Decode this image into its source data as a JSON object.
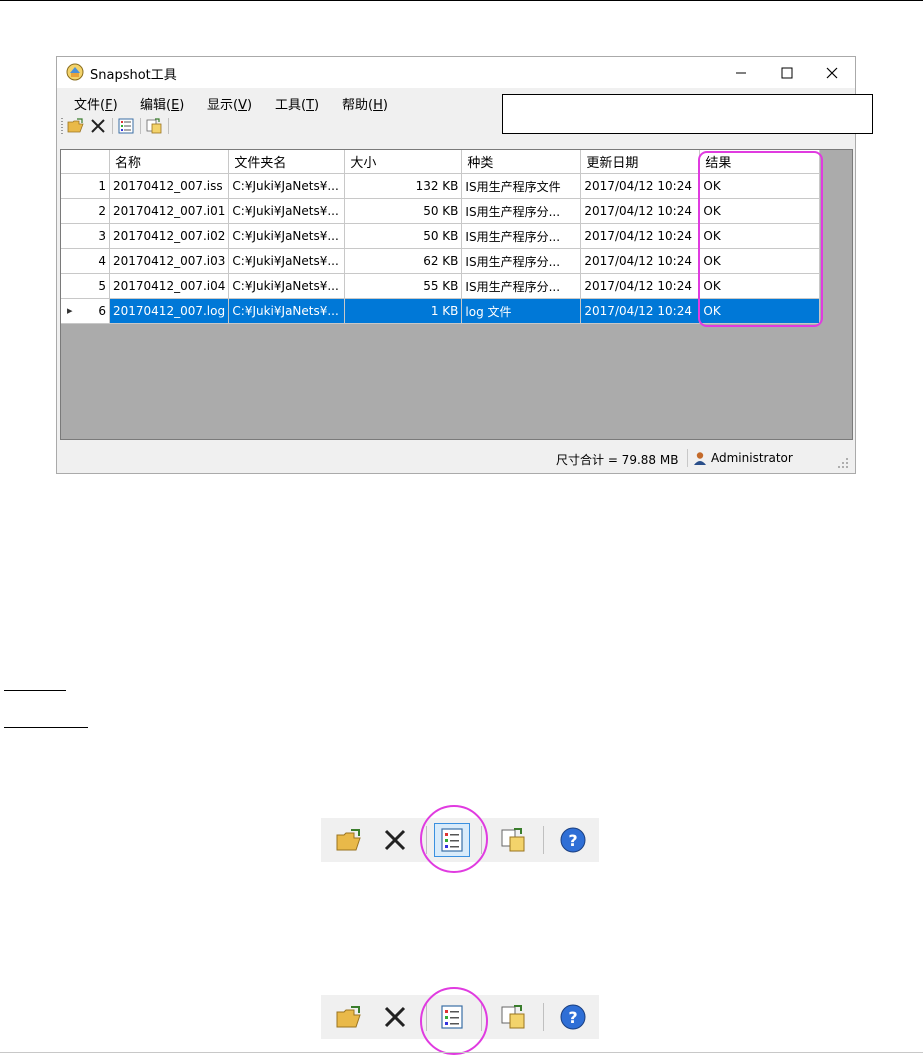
{
  "window": {
    "title": "Snapshot工具",
    "caption": {
      "minimize": "—",
      "maximize": "☐",
      "close": "✕"
    }
  },
  "menu": [
    {
      "label": "文件(",
      "key": "F",
      "tail": ")"
    },
    {
      "label": "编辑(",
      "key": "E",
      "tail": ")"
    },
    {
      "label": "显示(",
      "key": "V",
      "tail": ")"
    },
    {
      "label": "工具(",
      "key": "T",
      "tail": ")"
    },
    {
      "label": "帮助(",
      "key": "H",
      "tail": ")"
    }
  ],
  "grid": {
    "columns": [
      "名称",
      "文件夹名",
      "大小",
      "种类",
      "更新日期",
      "结果"
    ],
    "rows": [
      {
        "index": "1",
        "name": "20170412_007.iss",
        "folder": "C:¥Juki¥JaNets¥...",
        "size": "132 KB",
        "kind": "IS用生产程序文件",
        "date": "2017/04/12 10:24",
        "result": "OK",
        "selected": false
      },
      {
        "index": "2",
        "name": "20170412_007.i01",
        "folder": "C:¥Juki¥JaNets¥...",
        "size": "50 KB",
        "kind": "IS用生产程序分...",
        "date": "2017/04/12 10:24",
        "result": "OK",
        "selected": false
      },
      {
        "index": "3",
        "name": "20170412_007.i02",
        "folder": "C:¥Juki¥JaNets¥...",
        "size": "50 KB",
        "kind": "IS用生产程序分...",
        "date": "2017/04/12 10:24",
        "result": "OK",
        "selected": false
      },
      {
        "index": "4",
        "name": "20170412_007.i03",
        "folder": "C:¥Juki¥JaNets¥...",
        "size": "62 KB",
        "kind": "IS用生产程序分...",
        "date": "2017/04/12 10:24",
        "result": "OK",
        "selected": false
      },
      {
        "index": "5",
        "name": "20170412_007.i04",
        "folder": "C:¥Juki¥JaNets¥...",
        "size": "55 KB",
        "kind": "IS用生产程序分...",
        "date": "2017/04/12 10:24",
        "result": "OK",
        "selected": false
      },
      {
        "index": "6",
        "name": "20170412_007.log",
        "folder": "C:¥Juki¥JaNets¥...",
        "size": "1 KB",
        "kind": "log 文件",
        "date": "2017/04/12 10:24",
        "result": "OK",
        "selected": true
      }
    ]
  },
  "status": {
    "total": "尺寸合计 = 79.88 MB",
    "user": "Administrator"
  },
  "icons": {
    "open": "folder-open-icon",
    "delete": "delete-x-icon",
    "properties": "list-properties-icon",
    "export": "export-copy-icon",
    "help": "help-icon"
  },
  "colors": {
    "selection": "#0078d7",
    "highlight": "#e03be0",
    "grid_background": "#ababab"
  }
}
